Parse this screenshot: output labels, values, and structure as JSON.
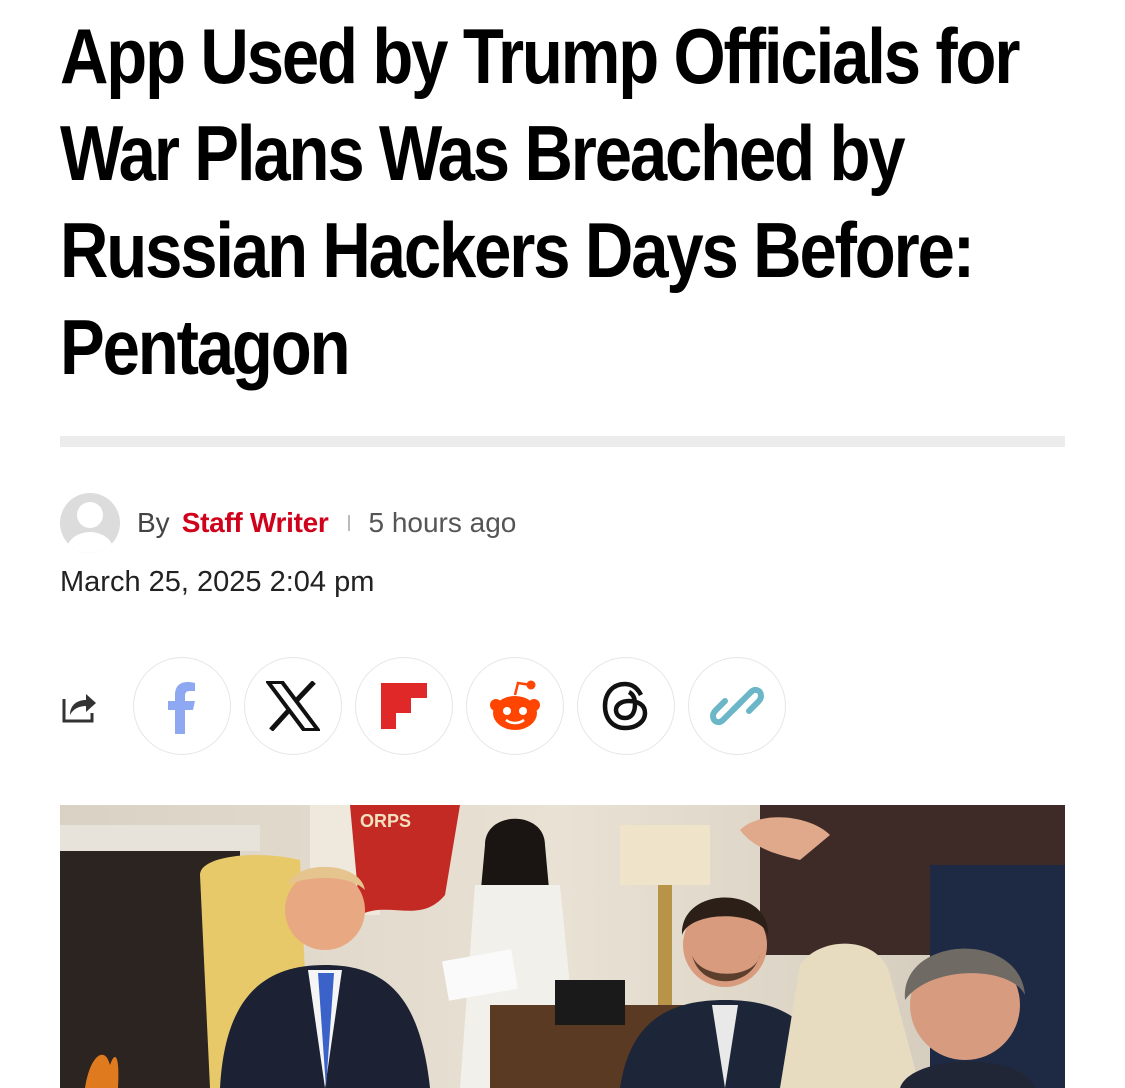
{
  "article": {
    "headline": "App Used by Trump Officials for War Plans Was Breached by Russian Hackers Days Before: Pentagon",
    "byline": {
      "by": "By",
      "author": "Staff Writer",
      "relative_time": "5 hours ago",
      "date": "March 25, 2025 2:04 pm"
    },
    "share": {
      "buttons": [
        {
          "name": "facebook",
          "icon": "facebook-icon",
          "color": "#8fa8f2"
        },
        {
          "name": "x",
          "icon": "x-icon",
          "color": "#111111"
        },
        {
          "name": "flipboard",
          "icon": "flipboard-icon",
          "color": "#e12828"
        },
        {
          "name": "reddit",
          "icon": "reddit-icon",
          "color": "#ff4500"
        },
        {
          "name": "threads",
          "icon": "threads-icon",
          "color": "#111111"
        },
        {
          "name": "copy-link",
          "icon": "link-icon",
          "color": "#6bb7c7"
        }
      ]
    },
    "image": {
      "banner_text": "ORPS"
    }
  },
  "colors": {
    "accent": "#d0021b",
    "divider": "#ececec"
  }
}
